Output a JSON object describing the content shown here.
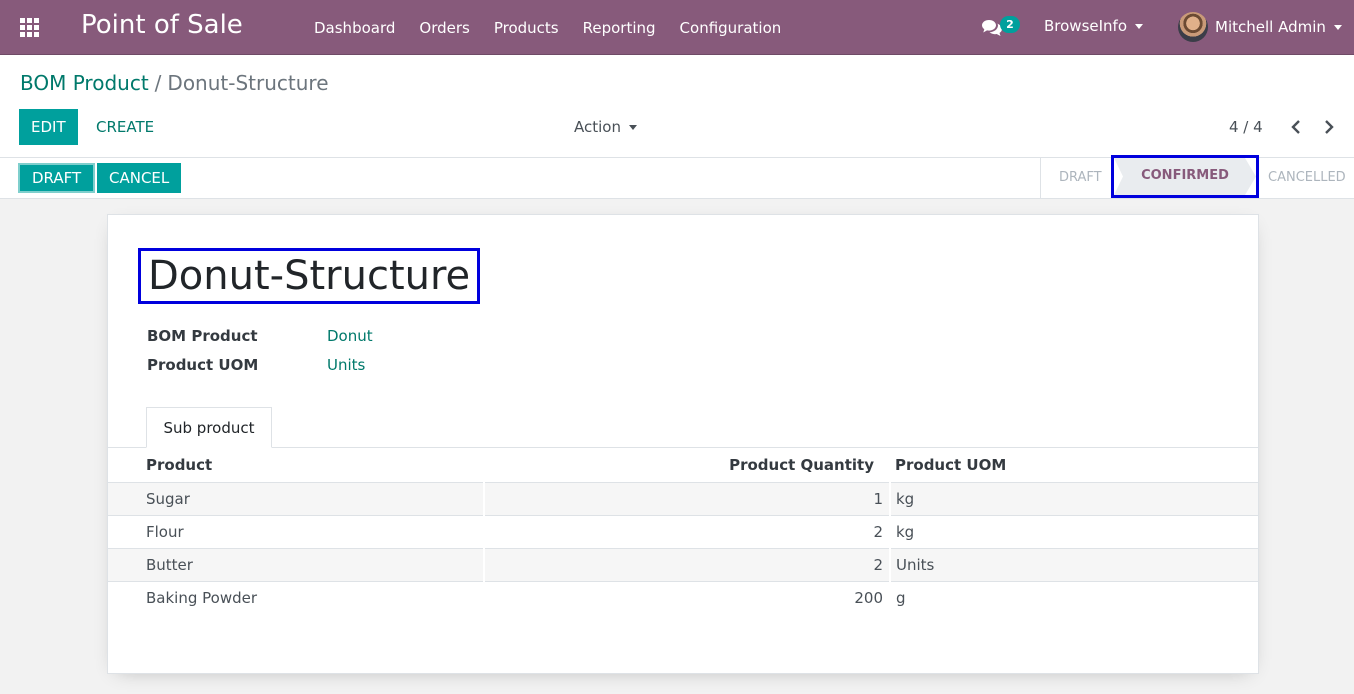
{
  "navbar": {
    "app_title": "Point of Sale",
    "menu": [
      "Dashboard",
      "Orders",
      "Products",
      "Reporting",
      "Configuration"
    ],
    "messages_count": "2",
    "company": "BrowseInfo",
    "user": "Mitchell Admin"
  },
  "control_panel": {
    "breadcrumb_parent": "BOM Product",
    "breadcrumb_separator": "/",
    "breadcrumb_current": "Donut-Structure",
    "edit_label": "EDIT",
    "create_label": "CREATE",
    "action_label": "Action",
    "pager": "4 / 4"
  },
  "statusbar": {
    "draft_button": "DRAFT",
    "cancel_button": "CANCEL",
    "stages": [
      "DRAFT",
      "CONFIRMED",
      "CANCELLED"
    ],
    "active_stage": "CONFIRMED"
  },
  "form": {
    "title": "Donut-Structure",
    "fields": [
      {
        "label": "BOM Product",
        "value": "Donut"
      },
      {
        "label": "Product UOM",
        "value": "Units"
      }
    ],
    "tab": "Sub product",
    "columns": [
      "Product",
      "Product Quantity",
      "Product UOM"
    ],
    "rows": [
      {
        "product": "Sugar",
        "qty": "1",
        "uom": "kg"
      },
      {
        "product": "Flour",
        "qty": "2",
        "uom": "kg"
      },
      {
        "product": "Butter",
        "qty": "2",
        "uom": "Units"
      },
      {
        "product": "Baking Powder",
        "qty": "200",
        "uom": "g"
      }
    ]
  },
  "colors": {
    "navbar": "#875a7b",
    "primary": "#00a09d",
    "link": "#00796b",
    "highlight": "#0000dd"
  }
}
